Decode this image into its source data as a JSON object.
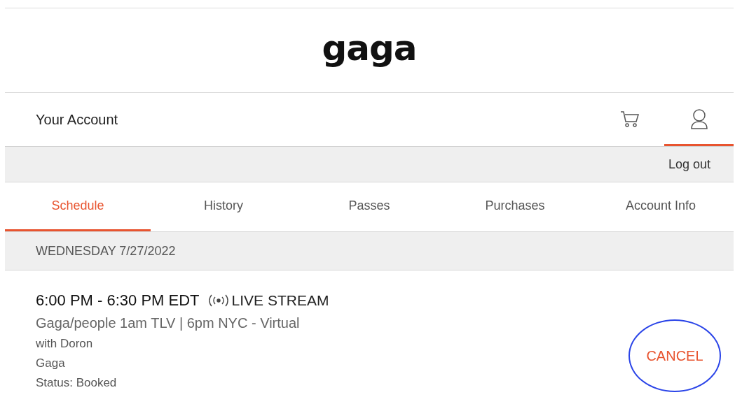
{
  "logo": "gaga",
  "account_bar": {
    "title": "Your Account",
    "icons": [
      {
        "kind": "cart",
        "selected": false
      },
      {
        "kind": "user",
        "selected": true
      }
    ]
  },
  "logout": "Log out",
  "tabs": [
    {
      "label": "Schedule",
      "selected": true
    },
    {
      "label": "History",
      "selected": false
    },
    {
      "label": "Passes",
      "selected": false
    },
    {
      "label": "Purchases",
      "selected": false
    },
    {
      "label": "Account Info",
      "selected": false
    }
  ],
  "date": "WEDNESDAY 7/27/2022",
  "event": {
    "time": "6:00 PM - 6:30 PM EDT",
    "badge": "LIVE STREAM",
    "title": "Gaga/people 1am TLV | 6pm NYC - Virtual",
    "details": [
      "with Doron",
      "Gaga",
      "Status: Booked"
    ],
    "button": "CANCEL"
  }
}
